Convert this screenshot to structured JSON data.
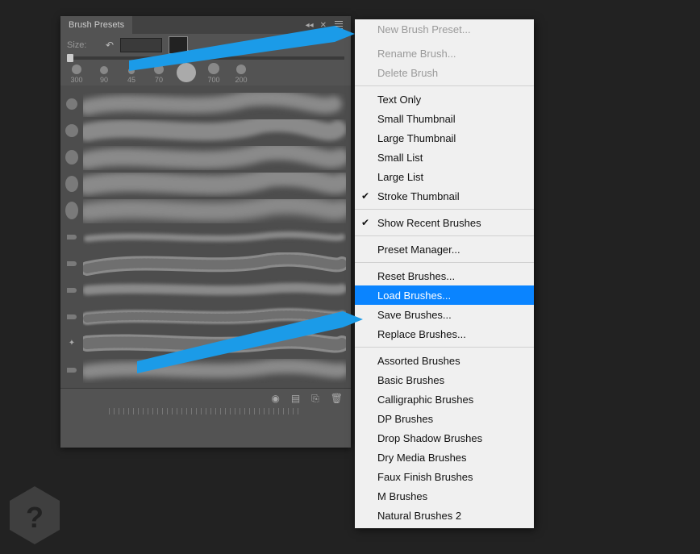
{
  "panel": {
    "title": "Brush Presets",
    "size_label": "Size:",
    "tips": [
      {
        "size": 300,
        "diam": 12
      },
      {
        "size": 90,
        "diam": 10
      },
      {
        "size": 45,
        "diam": 8
      },
      {
        "size": 70,
        "diam": 12
      },
      {
        "size": "",
        "diam": 24,
        "selected": true
      },
      {
        "size": 700,
        "diam": 14
      },
      {
        "size": 200,
        "diam": 12
      }
    ]
  },
  "menu": {
    "new_preset": "New Brush Preset...",
    "rename": "Rename Brush...",
    "delete": "Delete Brush",
    "text_only": "Text Only",
    "small_thumb": "Small Thumbnail",
    "large_thumb": "Large Thumbnail",
    "small_list": "Small List",
    "large_list": "Large List",
    "stroke_thumb": "Stroke Thumbnail",
    "show_recent": "Show Recent Brushes",
    "preset_mgr": "Preset Manager...",
    "reset": "Reset Brushes...",
    "load": "Load Brushes...",
    "save": "Save Brushes...",
    "replace": "Replace Brushes...",
    "sets": [
      "Assorted Brushes",
      "Basic Brushes",
      "Calligraphic Brushes",
      "DP Brushes",
      "Drop Shadow Brushes",
      "Dry Media Brushes",
      "Faux Finish Brushes",
      "M Brushes",
      "Natural Brushes 2"
    ]
  }
}
